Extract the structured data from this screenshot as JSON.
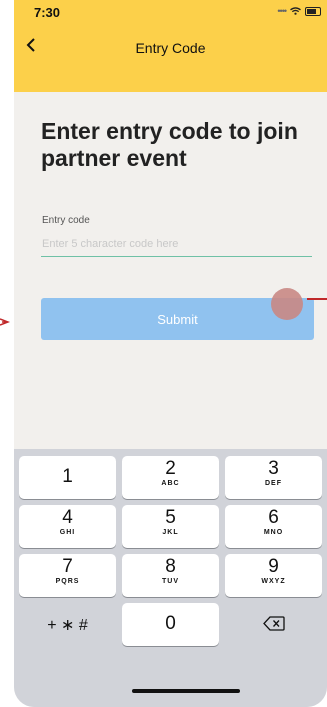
{
  "status": {
    "time": "7:30"
  },
  "header": {
    "title": "Entry Code",
    "back_icon": "chevron-left-icon"
  },
  "main": {
    "heading": "Enter entry code to join partner event",
    "field_label": "Entry code",
    "field_placeholder": "Enter 5 character code here",
    "submit_label": "Submit"
  },
  "keyboard": {
    "keys": [
      {
        "num": "1",
        "letters": ""
      },
      {
        "num": "2",
        "letters": "ABC"
      },
      {
        "num": "3",
        "letters": "DEF"
      },
      {
        "num": "4",
        "letters": "GHI"
      },
      {
        "num": "5",
        "letters": "JKL"
      },
      {
        "num": "6",
        "letters": "MNO"
      },
      {
        "num": "7",
        "letters": "PQRS"
      },
      {
        "num": "8",
        "letters": "TUV"
      },
      {
        "num": "9",
        "letters": "WXYZ"
      },
      {
        "num": "0",
        "letters": ""
      }
    ],
    "symbols_label": "+ ∗ #",
    "delete_icon": "backspace-icon"
  },
  "colors": {
    "header": "#fcd04a",
    "background": "#f2f0ed",
    "submit": "#90c2ef",
    "input_underline": "#6fc1a6",
    "annotation": "#c0282a"
  }
}
